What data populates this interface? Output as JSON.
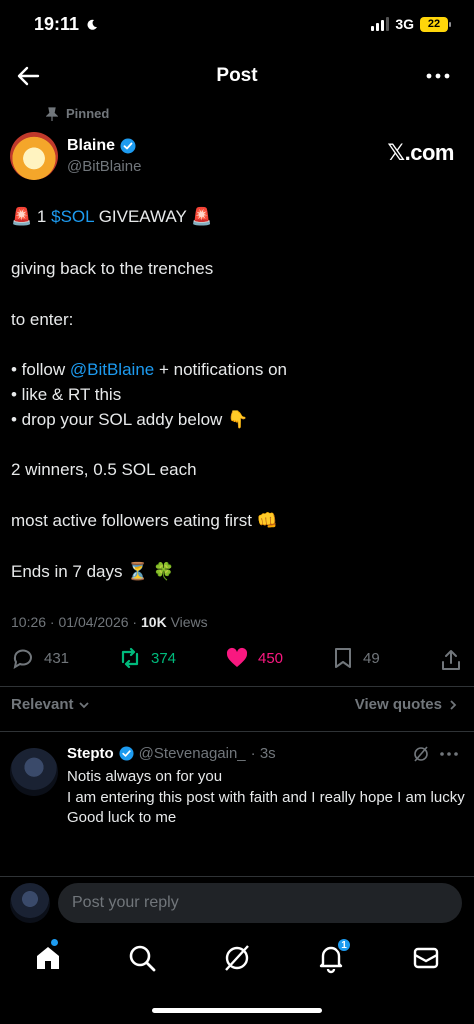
{
  "status": {
    "time": "19:11",
    "network": "3G",
    "battery": "22"
  },
  "nav": {
    "title": "Post"
  },
  "pinned_label": "Pinned",
  "author": {
    "name": "Blaine",
    "handle": "@BitBlaine"
  },
  "brand": "𝕏.com",
  "tweet": {
    "line1_num": "1",
    "line1_cashtag": "$SOL",
    "line1_word": "GIVEAWAY",
    "line2": "giving back to the trenches",
    "line3": "to enter:",
    "bullet1_prefix": "• follow ",
    "bullet1_mention": "@BitBlaine",
    "bullet1_suffix": " + notifications on",
    "bullet2": "• like & RT this",
    "bullet3": "• drop your SOL addy below",
    "line_winners": "2 winners, 0.5 SOL each",
    "line_active": "most active followers eating first",
    "line_ends": "Ends in 7 days"
  },
  "meta": {
    "time_date": "10:26 · 01/04/2026 · ",
    "views_count": "10K",
    "views_label": " Views"
  },
  "stats": {
    "replies": "431",
    "reposts": "374",
    "likes": "450",
    "bookmarks": "49"
  },
  "colors": {
    "accent": "#1d9bf0",
    "repost": "#00ba7c",
    "like": "#f91880",
    "muted": "#71767b"
  },
  "sort": {
    "relevant": "Relevant",
    "view_quotes": "View quotes"
  },
  "reply": {
    "name": "Stepto",
    "handle": "@Stevenagain_",
    "time": "· 3s",
    "lines": [
      "Notis always on for you",
      "I am entering this post with faith and I really hope I am lucky",
      "Good luck to me"
    ]
  },
  "compose": {
    "placeholder": "Post your reply"
  },
  "tabs": {
    "notifications_badge": "1"
  },
  "icons": [
    "back-arrow-icon",
    "more-icon",
    "pin-icon",
    "verified-icon",
    "reply-icon",
    "repost-icon",
    "heart-icon",
    "bookmark-icon",
    "share-icon",
    "grok-icon",
    "home-icon",
    "search-icon",
    "bell-icon",
    "mail-icon"
  ]
}
